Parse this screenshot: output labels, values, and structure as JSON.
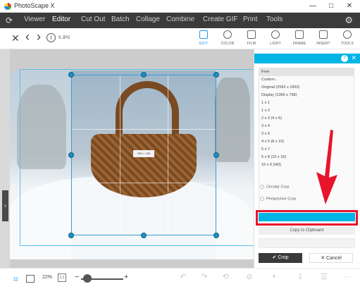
{
  "window": {
    "title": "PhotoScape X",
    "controls": [
      "—",
      "□",
      "✕"
    ]
  },
  "menu": {
    "items": [
      {
        "label": "Viewer",
        "active": false
      },
      {
        "label": "Editor",
        "active": true
      },
      {
        "label": "Cut Out",
        "active": false
      },
      {
        "label": "Batch",
        "active": false
      },
      {
        "label": "Collage",
        "active": false
      },
      {
        "label": "Combine",
        "active": false
      },
      {
        "label": "Create GIF",
        "active": false
      },
      {
        "label": "Print",
        "active": false
      },
      {
        "label": "Tools",
        "active": false
      }
    ],
    "settings_icon": "gear-icon"
  },
  "toolbar": {
    "close_glyph": "✕",
    "back_glyph": "‹",
    "forward_glyph": "›",
    "info_glyph": "i",
    "filename": "9.JPG",
    "tools": [
      {
        "label": "EDIT",
        "active": true
      },
      {
        "label": "COLOR",
        "active": false
      },
      {
        "label": "FILM",
        "active": false
      },
      {
        "label": "LIGHT",
        "active": false
      },
      {
        "label": "FRAME",
        "active": false
      },
      {
        "label": "INSERT",
        "active": false
      },
      {
        "label": "TOOLS",
        "active": false
      }
    ]
  },
  "canvas": {
    "size_tag": "206 × 136",
    "expand_glyph": "›"
  },
  "crop_panel": {
    "help_glyph": "?",
    "close_glyph": "✕",
    "ratios": [
      {
        "label": "Free",
        "selected": true
      },
      {
        "label": "Custom...",
        "selected": false
      },
      {
        "label": "Original (2592 x 1952)",
        "selected": false
      },
      {
        "label": "Display (1366 x 768)",
        "selected": false
      },
      {
        "label": "1 x 1",
        "selected": false
      },
      {
        "label": "1 x 2",
        "selected": false
      },
      {
        "label": "2 x 3 (4 x 6)",
        "selected": false
      },
      {
        "label": "3 x 4",
        "selected": false
      },
      {
        "label": "3 x 5",
        "selected": false
      },
      {
        "label": "4 x 5 (8 x 10)",
        "selected": false
      },
      {
        "label": "5 x 7",
        "selected": false
      },
      {
        "label": "5 x 8 (10 x 16)",
        "selected": false
      },
      {
        "label": "16 x 9 (HD)",
        "selected": false
      }
    ],
    "circular_crop": "Circular Crop",
    "perspective_crop": "Perspective Crop",
    "copy_to_clipboard": "Copy to Clipboard",
    "crop_label": "Crop",
    "crop_glyph": "✔",
    "cancel_label": "Cancel",
    "cancel_glyph": "✕"
  },
  "bottom_bar": {
    "zoom_value": "22%",
    "zoom_fit": "1:1",
    "zoom_minus": "−",
    "zoom_plus": "+",
    "actions": [
      "↶",
      "↷",
      "⟲",
      "⊘",
      "◐",
      "⇩",
      "☰",
      "⋯"
    ]
  },
  "colors": {
    "accent": "#00b4e6",
    "highlight": "#e8142c",
    "menubar": "#3b3b3b"
  }
}
